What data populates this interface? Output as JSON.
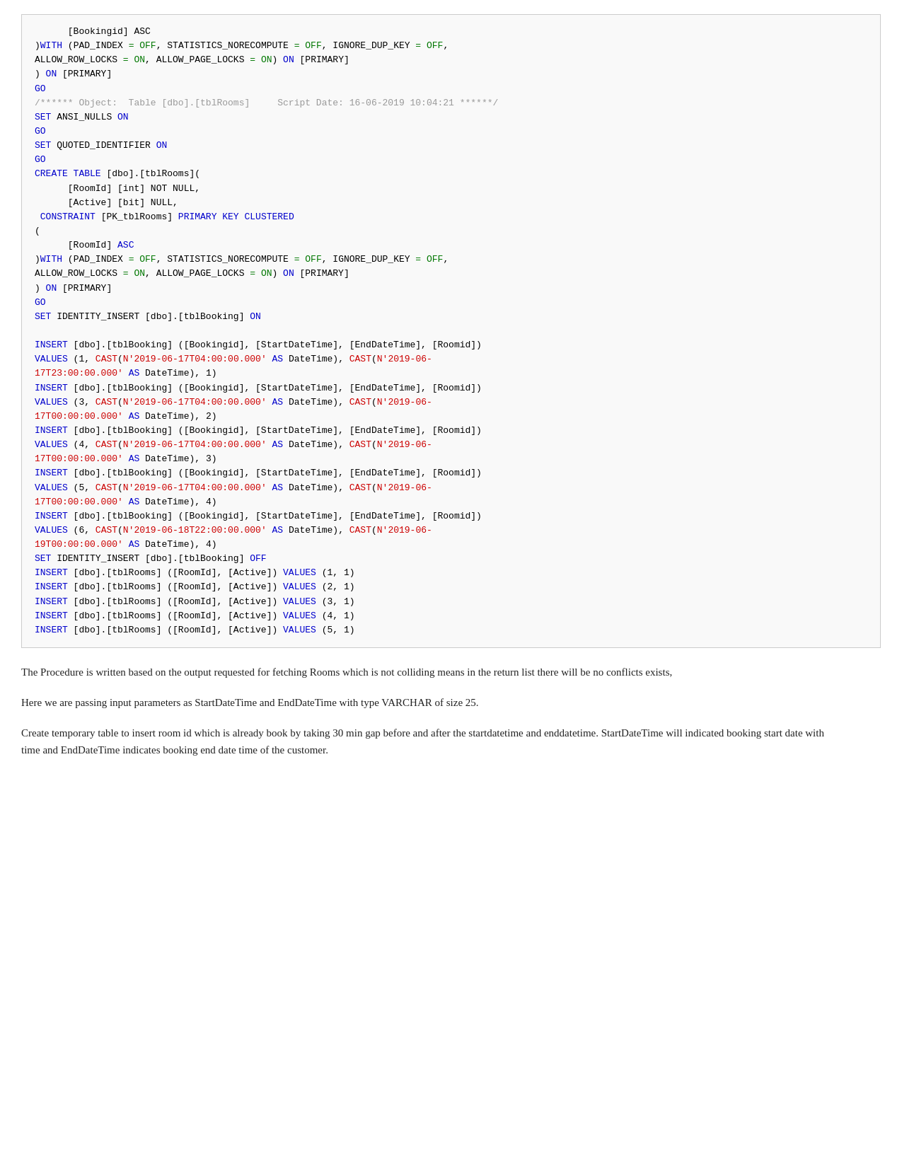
{
  "page": {
    "code_block": "sql_code",
    "paragraphs": [
      "The Procedure is written based on the output requested for fetching Rooms which is not colliding means in the return list there will be no conflicts exists,",
      "Here we are passing input parameters as StartDateTime and EndDateTime with type VARCHAR of size 25.",
      "Create temporary table to insert room id which is already book by taking 30 min gap before and after the startdatetime and enddatetime. StartDateTime will indicated booking start date with time and EndDateTime indicates booking end date time of the customer."
    ]
  }
}
